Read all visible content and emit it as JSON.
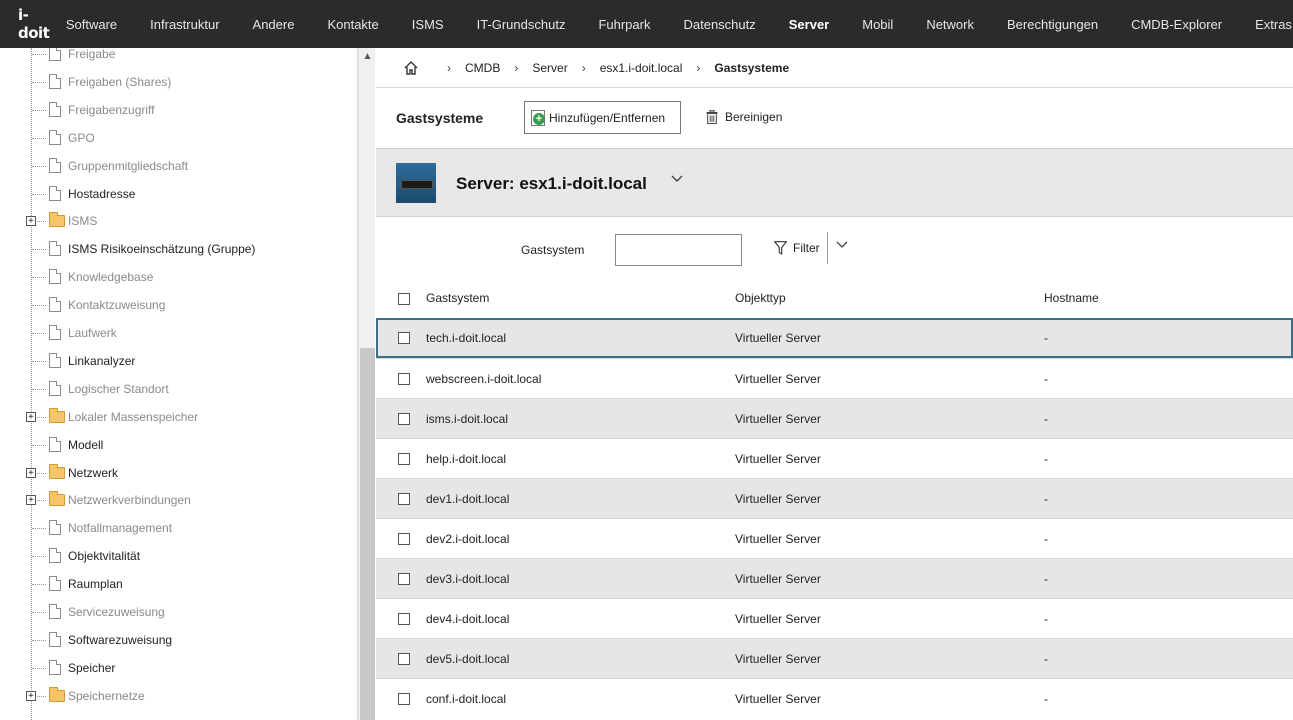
{
  "topnav": {
    "logo": "i-doit",
    "items": [
      "Software",
      "Infrastruktur",
      "Andere",
      "Kontakte",
      "ISMS",
      "IT-Grundschutz",
      "Fuhrpark",
      "Datenschutz",
      "Server",
      "Mobil",
      "Network",
      "Berechtigungen",
      "CMDB-Explorer",
      "Extras"
    ],
    "active": "Server"
  },
  "tree": {
    "items": [
      {
        "label": "Freigabe",
        "type": "doc",
        "enabled": false
      },
      {
        "label": "Freigaben (Shares)",
        "type": "doc",
        "enabled": false
      },
      {
        "label": "Freigabenzugriff",
        "type": "doc",
        "enabled": false
      },
      {
        "label": "GPO",
        "type": "doc",
        "enabled": false
      },
      {
        "label": "Gruppenmitgliedschaft",
        "type": "doc",
        "enabled": false
      },
      {
        "label": "Hostadresse",
        "type": "doc",
        "enabled": true
      },
      {
        "label": "ISMS",
        "type": "folder",
        "enabled": false
      },
      {
        "label": "ISMS Risikoeinschätzung (Gruppe)",
        "type": "doc",
        "enabled": true
      },
      {
        "label": "Knowledgebase",
        "type": "doc",
        "enabled": false
      },
      {
        "label": "Kontaktzuweisung",
        "type": "doc",
        "enabled": false
      },
      {
        "label": "Laufwerk",
        "type": "doc",
        "enabled": false
      },
      {
        "label": "Linkanalyzer",
        "type": "doc",
        "enabled": true
      },
      {
        "label": "Logischer Standort",
        "type": "doc",
        "enabled": false
      },
      {
        "label": "Lokaler Massenspeicher",
        "type": "folder",
        "enabled": false
      },
      {
        "label": "Modell",
        "type": "doc",
        "enabled": true
      },
      {
        "label": "Netzwerk",
        "type": "folder",
        "enabled": true
      },
      {
        "label": "Netzwerkverbindungen",
        "type": "folder",
        "enabled": false
      },
      {
        "label": "Notfallmanagement",
        "type": "doc",
        "enabled": false
      },
      {
        "label": "Objektvitalität",
        "type": "doc",
        "enabled": true
      },
      {
        "label": "Raumplan",
        "type": "doc",
        "enabled": true
      },
      {
        "label": "Servicezuweisung",
        "type": "doc",
        "enabled": false
      },
      {
        "label": "Softwarezuweisung",
        "type": "doc",
        "enabled": true
      },
      {
        "label": "Speicher",
        "type": "doc",
        "enabled": true
      },
      {
        "label": "Speichernetze",
        "type": "folder",
        "enabled": false
      }
    ]
  },
  "breadcrumb": {
    "items": [
      "CMDB",
      "Server",
      "esx1.i-doit.local",
      "Gastsysteme"
    ]
  },
  "toolbar": {
    "title": "Gastsysteme",
    "add_label": "Hinzufügen/Entfernen",
    "clean_label": "Bereinigen"
  },
  "object": {
    "title": "Server: esx1.i-doit.local"
  },
  "filter": {
    "label": "Gastsystem",
    "value": "",
    "button": "Filter"
  },
  "table": {
    "columns": [
      "Gastsystem",
      "Objekttyp",
      "Hostname"
    ],
    "rows": [
      [
        "tech.i-doit.local",
        "Virtueller Server",
        "-"
      ],
      [
        "webscreen.i-doit.local",
        "Virtueller Server",
        "-"
      ],
      [
        "isms.i-doit.local",
        "Virtueller Server",
        "-"
      ],
      [
        "help.i-doit.local",
        "Virtueller Server",
        "-"
      ],
      [
        "dev1.i-doit.local",
        "Virtueller Server",
        "-"
      ],
      [
        "dev2.i-doit.local",
        "Virtueller Server",
        "-"
      ],
      [
        "dev3.i-doit.local",
        "Virtueller Server",
        "-"
      ],
      [
        "dev4.i-doit.local",
        "Virtueller Server",
        "-"
      ],
      [
        "dev5.i-doit.local",
        "Virtueller Server",
        "-"
      ],
      [
        "conf.i-doit.local",
        "Virtueller Server",
        "-"
      ]
    ]
  },
  "colors": {
    "topnav_bg": "#2b2b2b",
    "row_alt": "#e6e6e6",
    "row_selected_border": "#3e6f86",
    "folder": "#f6c56a"
  }
}
